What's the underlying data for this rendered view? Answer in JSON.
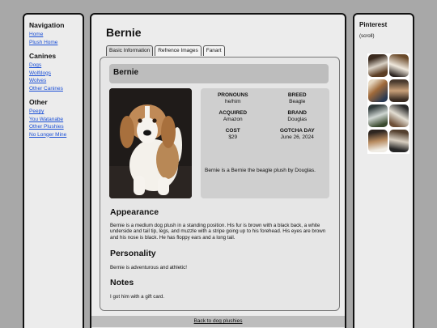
{
  "nav": {
    "title": "Navigation",
    "links": [
      "Home",
      "Plush Home"
    ],
    "canines_title": "Canines",
    "canines": [
      "Dogs",
      "Wolfdogs",
      "Wolves",
      "Other Canines"
    ],
    "other_title": "Other",
    "other": [
      "Peepy",
      "You Watanabe",
      "Other Plushies",
      "No Longer Mine"
    ]
  },
  "page": {
    "title": "Bernie",
    "tabs": [
      "Basic Information",
      "Refrence Images",
      "Fanart"
    ]
  },
  "card": {
    "name": "Bernie",
    "info": [
      {
        "key": "PRONOUNS",
        "value": "he/him"
      },
      {
        "key": "BREED",
        "value": "Beagle"
      },
      {
        "key": "ACQUIRED",
        "value": "Amazon"
      },
      {
        "key": "BRAND",
        "value": "Douglas"
      },
      {
        "key": "COST",
        "value": "$29"
      },
      {
        "key": "GOTCHA DAY",
        "value": "June 26, 2024"
      }
    ],
    "summary": "Bernie is a Bernie the beagle plush by Douglas.",
    "appearance_title": "Appearance",
    "appearance_text": "Bernie is a medium dog plush in a standing position. His fur is brown with a black back, a white underside and tail tip, legs, and muzzle with a stripe going up to his forehead. His eyes are brown and his nose is black. He has floppy ears and a long tail.",
    "personality_title": "Personality",
    "personality_text": "Bernie is adventurous and athletic!",
    "notes_title": "Notes",
    "notes_text": "I got him with a gift card."
  },
  "footer": {
    "back_link": "Back to dog plushies"
  },
  "pinterest": {
    "title": "Pinterest",
    "subtitle": "(scroll)"
  },
  "colors": {
    "background": "#a8a8a8",
    "panel": "#ececec",
    "link": "#1a4fd6",
    "header_bar": "#bdbdbd"
  }
}
